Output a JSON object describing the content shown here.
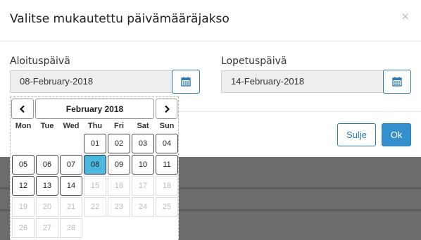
{
  "modal": {
    "title": "Valitse mukautettu päivämääräjakso",
    "close_label": "×"
  },
  "start": {
    "label": "Aloituspäivä",
    "value": "08-February-2018"
  },
  "end": {
    "label": "Lopetuspäivä",
    "value": "14-February-2018"
  },
  "buttons": {
    "close_label": "Sulje",
    "ok_label": "Ok"
  },
  "calendar": {
    "month_label": "February 2018",
    "weekdays": [
      "Mon",
      "Tue",
      "Wed",
      "Thu",
      "Fri",
      "Sat",
      "Sun"
    ],
    "weeks": [
      [
        "",
        "",
        "",
        "01",
        "02",
        "03",
        "04"
      ],
      [
        "05",
        "06",
        "07",
        "08",
        "09",
        "10",
        "11"
      ],
      [
        "12",
        "13",
        "14",
        "15",
        "16",
        "17",
        "18"
      ],
      [
        "19",
        "20",
        "21",
        "22",
        "23",
        "24",
        "25"
      ],
      [
        "26",
        "27",
        "28",
        "",
        "",
        "",
        ""
      ]
    ],
    "selected_day": "08",
    "last_enabled_day": "14",
    "selected_color": "#4bb8e0"
  },
  "colors": {
    "primary": "#3390cc",
    "backdrop": "#6c6c6c"
  },
  "icons": {
    "calendar": "calendar-icon",
    "prev": "chevron-left-icon",
    "next": "chevron-right-icon"
  }
}
